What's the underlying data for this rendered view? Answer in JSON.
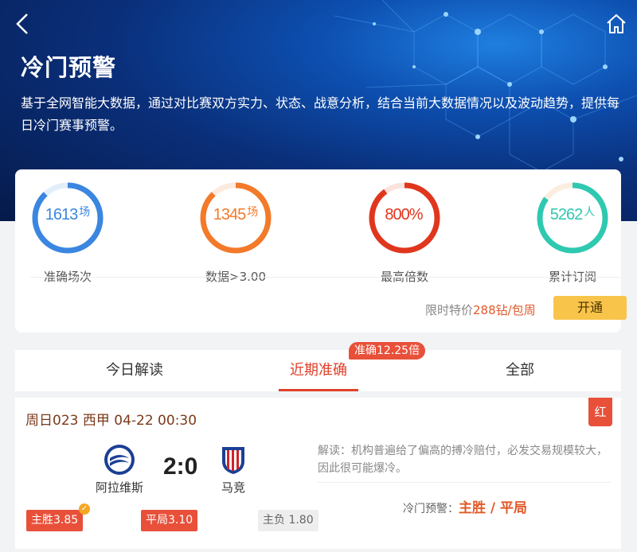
{
  "header": {
    "title": "冷门预警",
    "description": "基于全网智能大数据，通过对比赛双方实力、状态、战意分析，结合当前大数据情况以及波动趋势，提供每日冷门赛事预警。"
  },
  "stats": [
    {
      "value": "1613",
      "unit": "场",
      "label": "准确场次",
      "color": "#3a86e0",
      "progress": 0.88
    },
    {
      "value": "1345",
      "unit": "场",
      "label": "数据>3.00",
      "color": "#f27a2a",
      "progress": 0.88
    },
    {
      "value": "800%",
      "unit": "",
      "label": "最高倍数",
      "color": "#e0361e",
      "progress": 0.9
    },
    {
      "value": "5262",
      "unit": "人",
      "label": "累计订阅",
      "color": "#2ec9b0",
      "progress": 0.85
    }
  ],
  "promo": {
    "prefix": "限时特价",
    "price": "288钻/包周",
    "button": "开通"
  },
  "tabs": {
    "items": [
      "今日解读",
      "近期准确",
      "全部"
    ],
    "active_index": 1,
    "badge": "准确12.25倍"
  },
  "match": {
    "header": "周日023 西甲 04-22 00:30",
    "result_tag": "红",
    "home_team": "阿拉维斯",
    "away_team": "马竞",
    "score": "2:0",
    "odds": [
      {
        "label": "主胜3.85",
        "selected": true
      },
      {
        "label": "平局3.10",
        "selected": true
      },
      {
        "label": "主负 1.80",
        "selected": false
      }
    ],
    "analysis": "解读：机构普遍给了偏高的搏冷赔付，必发交易规模较大，因此很可能爆冷。",
    "warning_label": "冷门预警：",
    "warning_value": "主胜 / 平局"
  },
  "icons": {
    "back": "chevron-left-icon",
    "home": "home-icon",
    "check": "check-badge-icon"
  },
  "colors": {
    "accent": "#e8503a",
    "button": "#f8c44a"
  }
}
